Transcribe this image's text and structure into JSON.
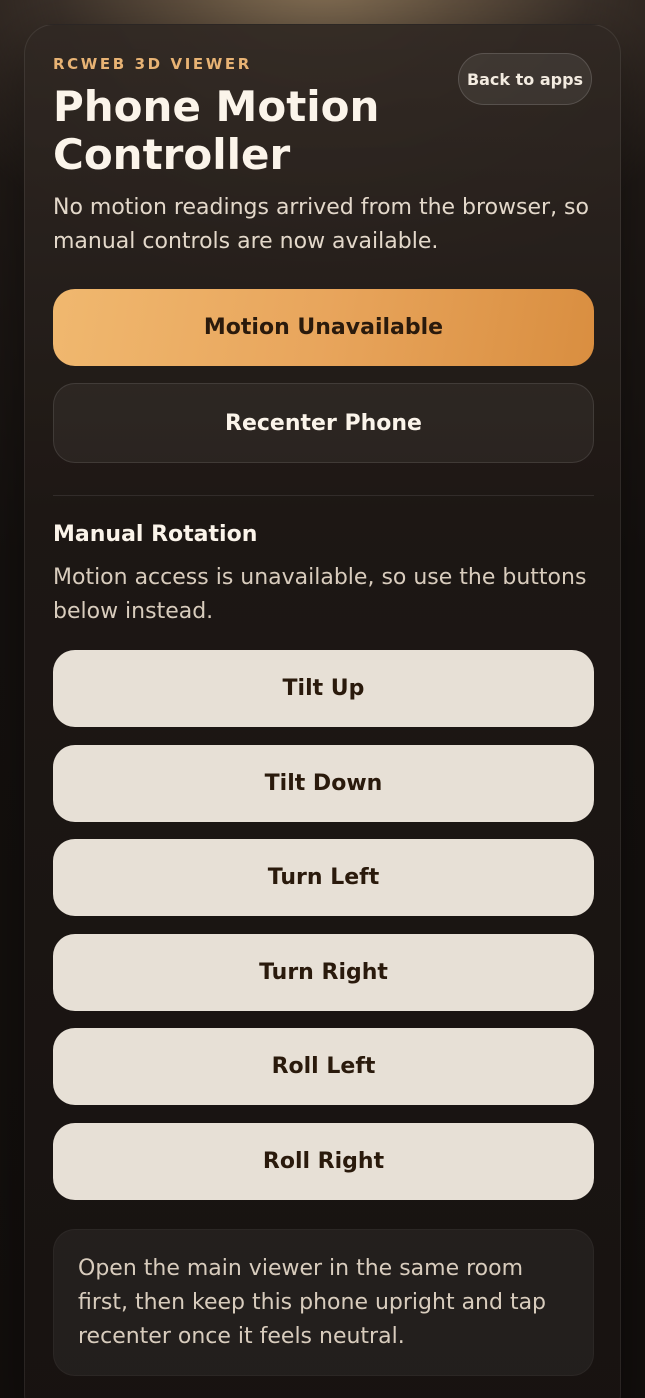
{
  "header": {
    "eyebrow": "RCWEB 3D VIEWER",
    "title": "Phone Motion Controller",
    "back_label": "Back to apps",
    "status_message": "No motion readings arrived from the browser, so manual controls are now available."
  },
  "actions": {
    "motion_label": "Motion Unavailable",
    "recenter_label": "Recenter Phone"
  },
  "manual": {
    "title": "Manual Rotation",
    "description": "Motion access is unavailable, so use the buttons below instead.",
    "buttons": [
      {
        "label": "Tilt Up"
      },
      {
        "label": "Tilt Down"
      },
      {
        "label": "Turn Left"
      },
      {
        "label": "Turn Right"
      },
      {
        "label": "Roll Left"
      },
      {
        "label": "Roll Right"
      }
    ]
  },
  "note": {
    "text": "Open the main viewer in the same room first, then keep this phone upright and tap recenter once it feels neutral."
  },
  "colors": {
    "accent": "#e8a55c",
    "eyebrow": "#e8b374",
    "button_light": "#e7e0d6",
    "background": "#15110f"
  }
}
